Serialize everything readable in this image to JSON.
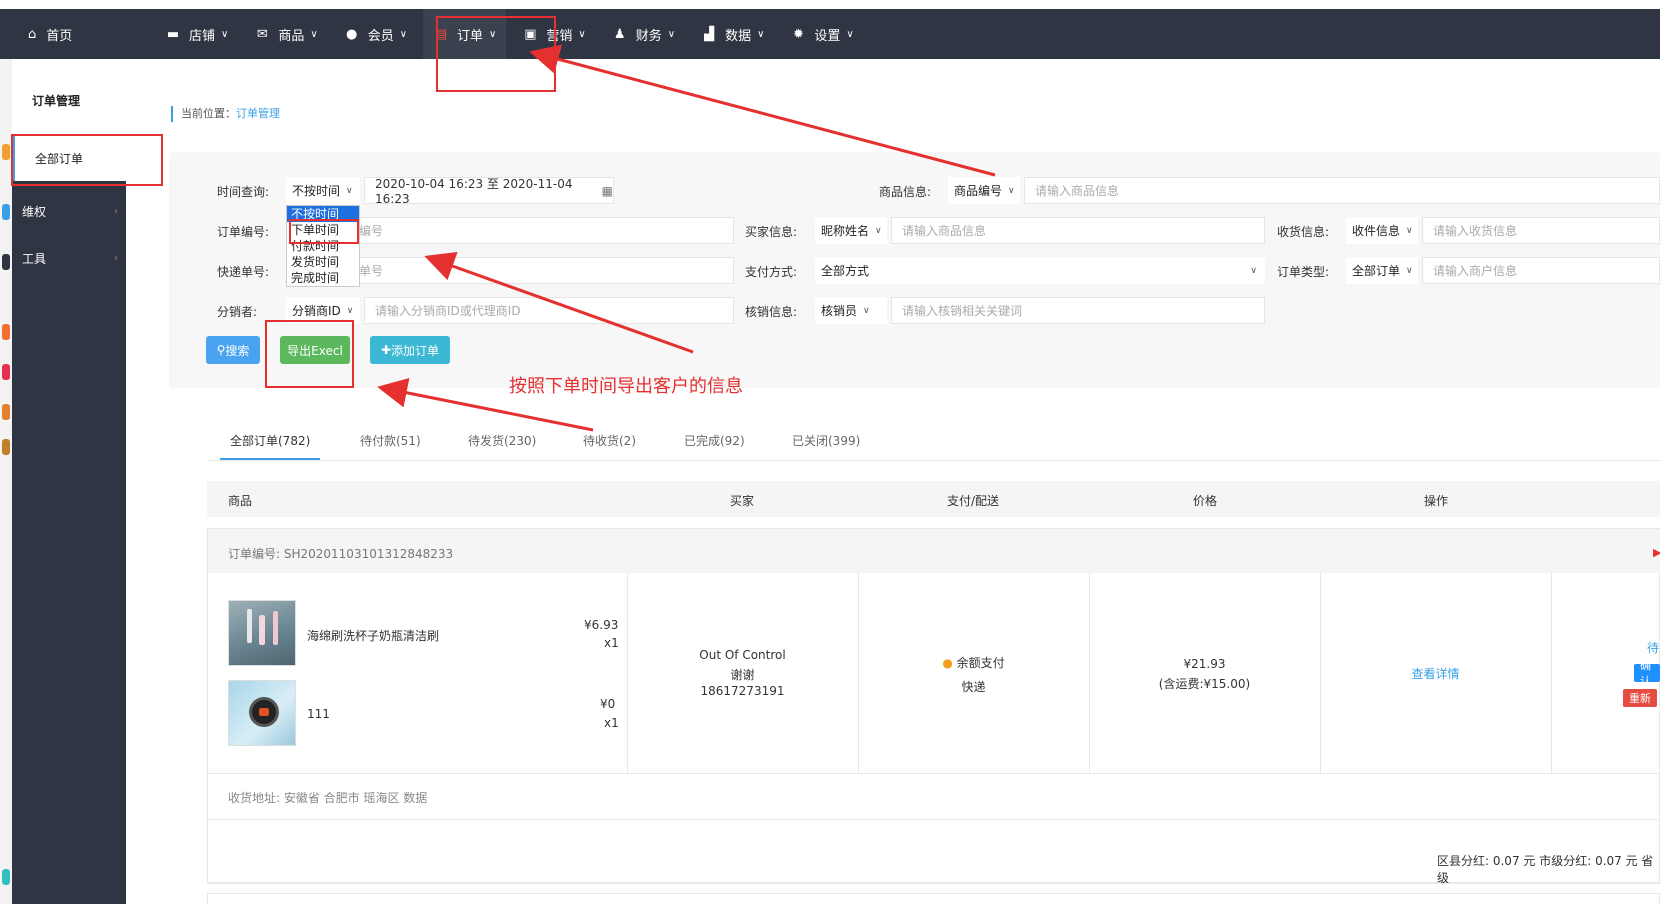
{
  "topnav": {
    "home": "首页",
    "items": [
      {
        "label": "店铺",
        "icon": "store-icon"
      },
      {
        "label": "商品",
        "icon": "product-icon"
      },
      {
        "label": "会员",
        "icon": "user-icon"
      },
      {
        "label": "订单",
        "icon": "order-icon"
      },
      {
        "label": "营销",
        "icon": "gift-icon"
      },
      {
        "label": "财务",
        "icon": "money-bag-icon"
      },
      {
        "label": "数据",
        "icon": "chart-icon"
      },
      {
        "label": "设置",
        "icon": "gear-icon"
      }
    ]
  },
  "sidebar": {
    "title": "订单管理",
    "active": "全部订单",
    "items": [
      "维权",
      "工具"
    ]
  },
  "breadcrumb": {
    "prefix": "当前位置：",
    "current": "订单管理"
  },
  "filters": {
    "time_label": "时间查询:",
    "time_select": "不按时间",
    "date_range": "2020-10-04 16:23 至 2020-11-04 16:23",
    "time_options": [
      "不按时间",
      "下单时间",
      "付款时间",
      "发货时间",
      "完成时间"
    ],
    "goods_label": "商品信息:",
    "goods_select": "商品编号",
    "goods_placeholder": "请输入商品信息",
    "order_no_label": "订单编号:",
    "order_no_placeholder": "编号",
    "buyer_label": "买家信息:",
    "buyer_select": "昵称姓名",
    "buyer_placeholder": "请输入商品信息",
    "receive_label": "收货信息:",
    "receive_select": "收件信息",
    "receive_placeholder": "请输入收货信息",
    "express_label": "快递单号:",
    "express_placeholder": "单号",
    "pay_label": "支付方式:",
    "pay_select": "全部方式",
    "order_type_label": "订单类型:",
    "order_type_select": "全部订单",
    "order_type_placeholder": "请输入商户信息",
    "distributor_label": "分销者:",
    "distributor_select": "分销商ID",
    "distributor_placeholder": "请输入分销商ID或代理商ID",
    "verify_label": "核销信息:",
    "verify_select": "核销员",
    "verify_placeholder": "请输入核销相关关键词"
  },
  "buttons": {
    "search": "搜索",
    "export": "导出Execl",
    "add": "添加订单"
  },
  "annotation": "按照下单时间导出客户的信息",
  "tabs": [
    "全部订单(782)",
    "待付款(51)",
    "待发货(230)",
    "待收货(2)",
    "已完成(92)",
    "已关闭(399)"
  ],
  "table_headers": [
    "商品",
    "买家",
    "支付/配送",
    "价格",
    "操作"
  ],
  "order": {
    "number": "订单编号: SH20201103101312848233",
    "products": [
      {
        "name": "海绵刷洗杯子奶瓶清洁刷",
        "price": "¥6.93",
        "qty": "x1"
      },
      {
        "name": "111",
        "price": "¥0",
        "qty": "x1"
      }
    ],
    "buyer": {
      "name": "Out Of Control",
      "nickname": "谢谢",
      "phone": "18617273191"
    },
    "payment": "余额支付",
    "delivery": "快递",
    "price": "¥21.93",
    "freight": "(含运费:¥15.00)",
    "action": "查看详情",
    "status_partial": "待",
    "confirm_partial": "确认",
    "refresh_partial": "重新",
    "address": "收货地址: 安徽省 合肥市 瑶海区 数据",
    "footer": "区县分红: 0.07 元 市级分红: 0.07 元 省级"
  },
  "colors": {
    "nav_bg": "#2f3542",
    "accent": "#3aa0e6",
    "export_btn": "#5cb85c",
    "add_btn": "#3ab8d4",
    "annotation": "#e53030"
  }
}
